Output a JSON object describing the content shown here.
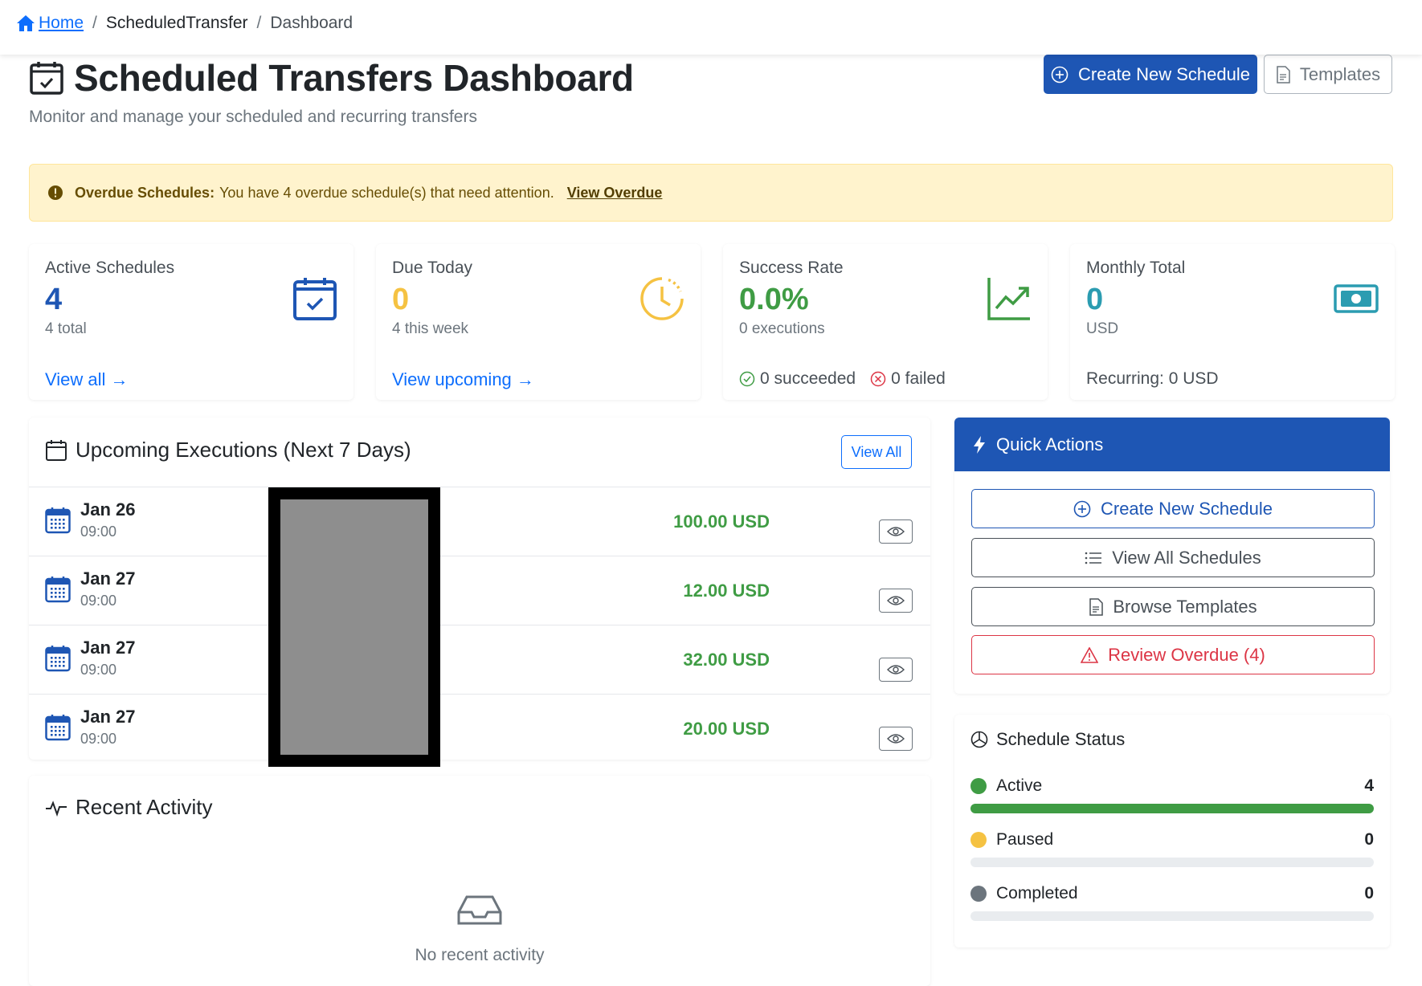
{
  "breadcrumb": {
    "home": "Home",
    "section": "ScheduledTransfer",
    "current": "Dashboard"
  },
  "header": {
    "title": "Scheduled Transfers Dashboard",
    "subtitle": "Monitor and manage your scheduled and recurring transfers",
    "create_label": "Create New Schedule",
    "templates_label": "Templates"
  },
  "alert": {
    "title": "Overdue Schedules:",
    "message": "You have 4 overdue schedule(s) that need attention.",
    "link": "View Overdue"
  },
  "stats": {
    "active": {
      "label": "Active Schedules",
      "value": "4",
      "sub": "4 total",
      "link": "View all →"
    },
    "due": {
      "label": "Due Today",
      "value": "0",
      "sub": "4 this week",
      "link": "View upcoming →"
    },
    "success": {
      "label": "Success Rate",
      "value": "0.0%",
      "sub": "0 executions",
      "succeeded": "0 succeeded",
      "failed": "0 failed"
    },
    "monthly": {
      "label": "Monthly Total",
      "value": "0",
      "sub": "USD",
      "foot": "Recurring: 0 USD"
    }
  },
  "upcoming": {
    "title": "Upcoming Executions (Next 7 Days)",
    "view_all": "View All",
    "rows": [
      {
        "date": "Jan 26",
        "time": "09:00",
        "amount": "100.00 USD"
      },
      {
        "date": "Jan 27",
        "time": "09:00",
        "amount": "12.00 USD"
      },
      {
        "date": "Jan 27",
        "time": "09:00",
        "amount": "32.00 USD"
      },
      {
        "date": "Jan 27",
        "time": "09:00",
        "amount": "20.00 USD"
      }
    ]
  },
  "recent": {
    "title": "Recent Activity",
    "empty": "No recent activity"
  },
  "quick_actions": {
    "title": "Quick Actions",
    "create": "Create New Schedule",
    "view_all": "View All Schedules",
    "browse": "Browse Templates",
    "overdue": "Review Overdue (4)"
  },
  "status": {
    "title": "Schedule Status",
    "items": [
      {
        "label": "Active",
        "count": "4",
        "fraction": 1.0,
        "color": "#3f9c44"
      },
      {
        "label": "Paused",
        "count": "0",
        "fraction": 0.0,
        "color": "#f5c242"
      },
      {
        "label": "Completed",
        "count": "0",
        "fraction": 0.0,
        "color": "#6c757d"
      }
    ]
  },
  "colors": {
    "primary": "#1e56b4",
    "link": "#0d6efd",
    "success": "#3f9c44",
    "warning": "#f5c242",
    "danger": "#dc3545",
    "info": "#2b9cb1"
  }
}
